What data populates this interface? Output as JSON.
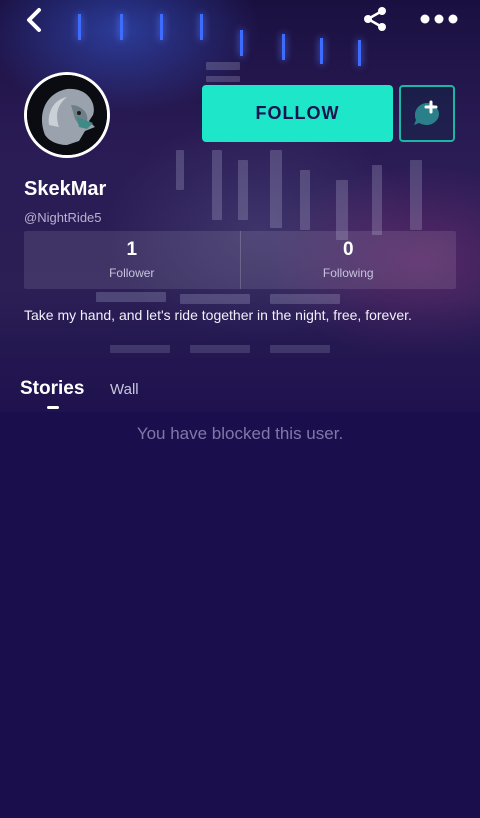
{
  "nav": {
    "back_icon": "chevron-left-icon",
    "share_icon": "share-icon",
    "more_icon": "more-dots-icon"
  },
  "profile": {
    "avatar_icon": "lion-avatar",
    "follow_label": "FOLLOW",
    "chat_icon": "chat-add-icon",
    "name": "SkekMar",
    "handle": "@NightRide5",
    "bio": "Take my hand, and let's ride together in the night, free, forever."
  },
  "stats": {
    "followers_count": "1",
    "followers_label": "Follower",
    "following_count": "0",
    "following_label": "Following"
  },
  "tabs": {
    "stories": "Stories",
    "wall": "Wall"
  },
  "content": {
    "blocked_message": "You have blocked this user."
  },
  "colors": {
    "background": "#1b0e4c",
    "accent": "#1de6c9",
    "muted_text": "#7f78a8"
  }
}
